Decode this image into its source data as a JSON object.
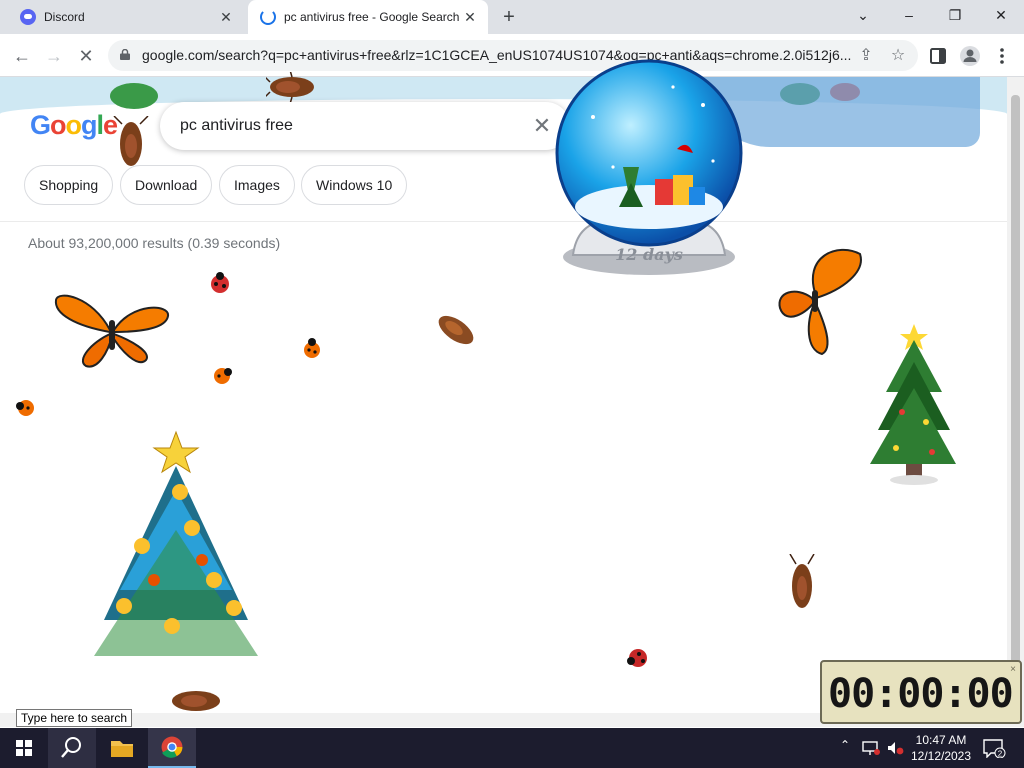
{
  "tabs": [
    {
      "title": "Discord",
      "active": false
    },
    {
      "title": "pc antivirus free - Google Search",
      "active": true
    }
  ],
  "icons": {
    "minimize": "–",
    "restore": "❐",
    "close": "✕",
    "down": "⌄",
    "back": "←",
    "forward": "→",
    "stop": "✕",
    "share": "⇪",
    "star": "☆",
    "tab_close": "✕",
    "new_tab": "+"
  },
  "address": {
    "url": "google.com/search?q=pc+antivirus+free&rlz=1C1GCEA_enUS1074US1074&oq=pc+anti&aqs=chrome.2.0i512j6..."
  },
  "search": {
    "query": "pc antivirus free",
    "clear": "✕"
  },
  "logo": {
    "letters": [
      "G",
      "o",
      "o",
      "g",
      "l",
      "e"
    ]
  },
  "chips": [
    "Shopping",
    "Download",
    "Images",
    "Windows 10"
  ],
  "results_stats": "About 93,200,000 results (0.39 seconds)",
  "globe": {
    "label": "12 days"
  },
  "timer": {
    "value": "00:00:00",
    "close": "×"
  },
  "taskbar": {
    "search_tooltip": "Type here to search",
    "clock_time": "10:47 AM",
    "clock_date": "12/12/2023",
    "notifications": "2"
  },
  "colors": {
    "google_blue": "#4285f4",
    "google_red": "#ea4335",
    "google_yellow": "#fbbc05",
    "google_green": "#34a853",
    "taskbar": "#1c1c2e",
    "tab_strip": "#dee1e6"
  }
}
